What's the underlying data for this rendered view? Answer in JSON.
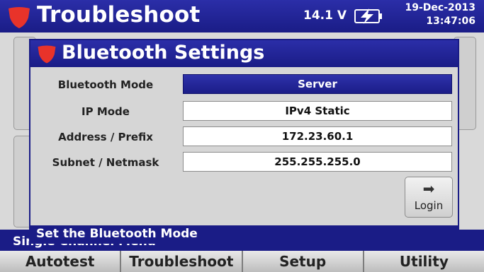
{
  "header": {
    "title": "Troubleshoot",
    "voltage": "14.1 V",
    "date": "19-Dec-2013",
    "time": "13:47:06",
    "logo_icon": "red-shield-icon",
    "battery_icon": "charging-battery-icon"
  },
  "background": {
    "status_text": "Single Channel Menu"
  },
  "tabs": [
    {
      "label": "Autotest"
    },
    {
      "label": "Troubleshoot"
    },
    {
      "label": "Setup"
    },
    {
      "label": "Utility"
    }
  ],
  "dialog": {
    "title": "Bluetooth Settings",
    "rows": [
      {
        "label": "Bluetooth Mode",
        "value": "Server",
        "selected": true
      },
      {
        "label": "IP Mode",
        "value": "IPv4 Static"
      },
      {
        "label": "Address / Prefix",
        "value": "172.23.60.1"
      },
      {
        "label": "Subnet / Netmask",
        "value": "255.255.255.0"
      }
    ],
    "login_label": "Login",
    "login_icon": "right-arrow-icon",
    "status_text": "Set the Bluetooth Mode"
  },
  "colors": {
    "brand_blue": "#1a1c86",
    "accent_red": "#e8332a"
  }
}
